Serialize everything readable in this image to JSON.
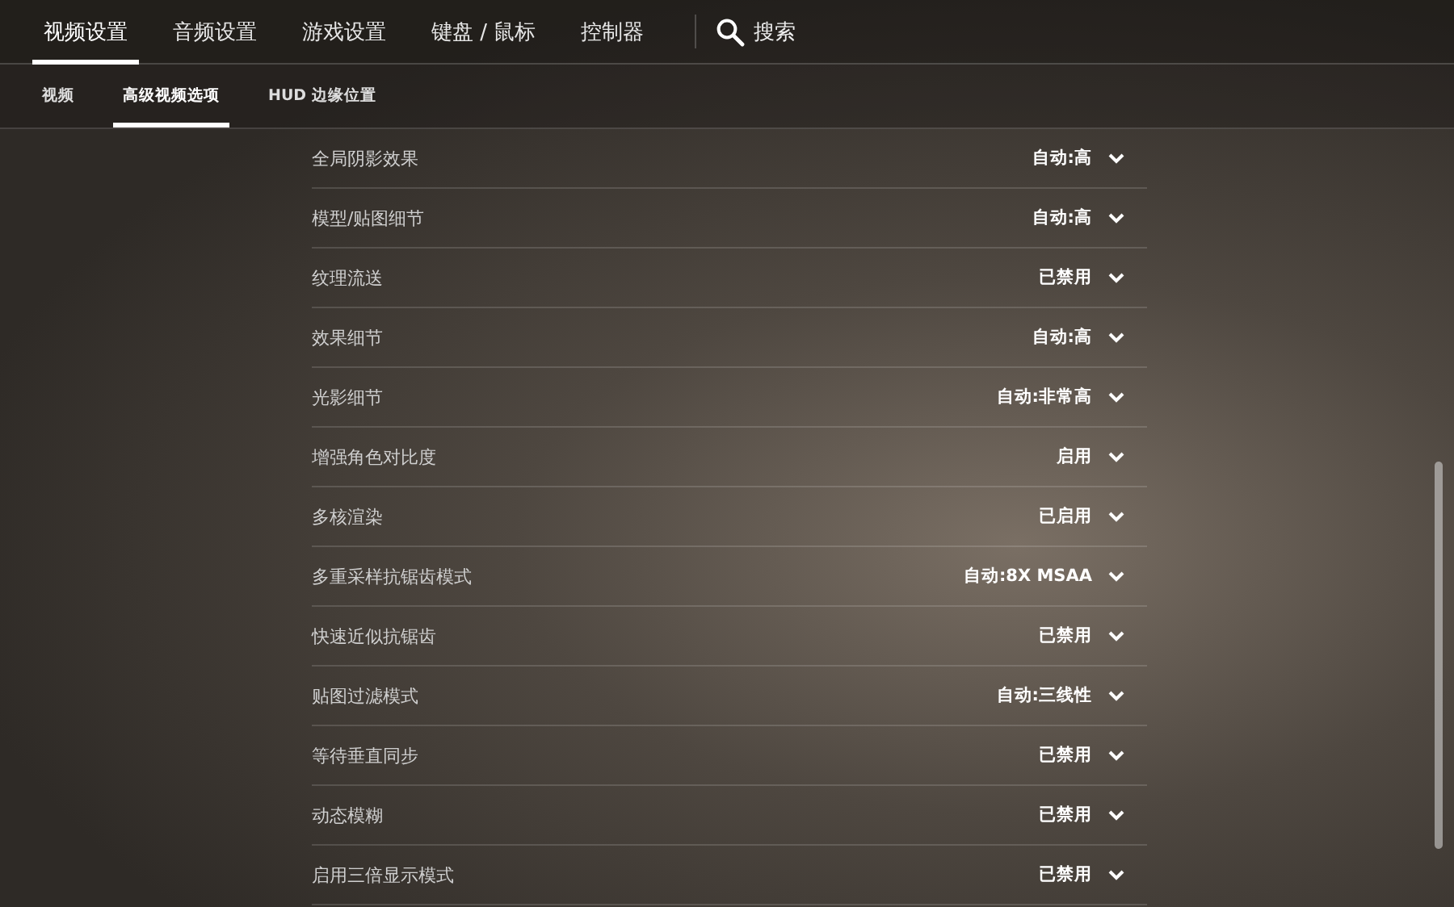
{
  "main_tabs": [
    {
      "label": "视频设置",
      "selected": true
    },
    {
      "label": "音频设置",
      "selected": false
    },
    {
      "label": "游戏设置",
      "selected": false
    },
    {
      "label": "键盘 / 鼠标",
      "selected": false
    },
    {
      "label": "控制器",
      "selected": false
    }
  ],
  "search": {
    "label": "搜索"
  },
  "sub_tabs": [
    {
      "label": "视频",
      "selected": false
    },
    {
      "label": "高级视频选项",
      "selected": true
    },
    {
      "label": "HUD 边缘位置",
      "selected": false
    }
  ],
  "settings": [
    {
      "label": "全局阴影效果",
      "value": "自动:高"
    },
    {
      "label": "模型/贴图细节",
      "value": "自动:高"
    },
    {
      "label": "纹理流送",
      "value": "已禁用"
    },
    {
      "label": "效果细节",
      "value": "自动:高"
    },
    {
      "label": "光影细节",
      "value": "自动:非常高"
    },
    {
      "label": "增强角色对比度",
      "value": "启用"
    },
    {
      "label": "多核渲染",
      "value": "已启用"
    },
    {
      "label": "多重采样抗锯齿模式",
      "value": "自动:8X MSAA"
    },
    {
      "label": "快速近似抗锯齿",
      "value": "已禁用"
    },
    {
      "label": "贴图过滤模式",
      "value": "自动:三线性"
    },
    {
      "label": "等待垂直同步",
      "value": "已禁用"
    },
    {
      "label": "动态模糊",
      "value": "已禁用"
    },
    {
      "label": "启用三倍显示模式",
      "value": "已禁用"
    }
  ]
}
